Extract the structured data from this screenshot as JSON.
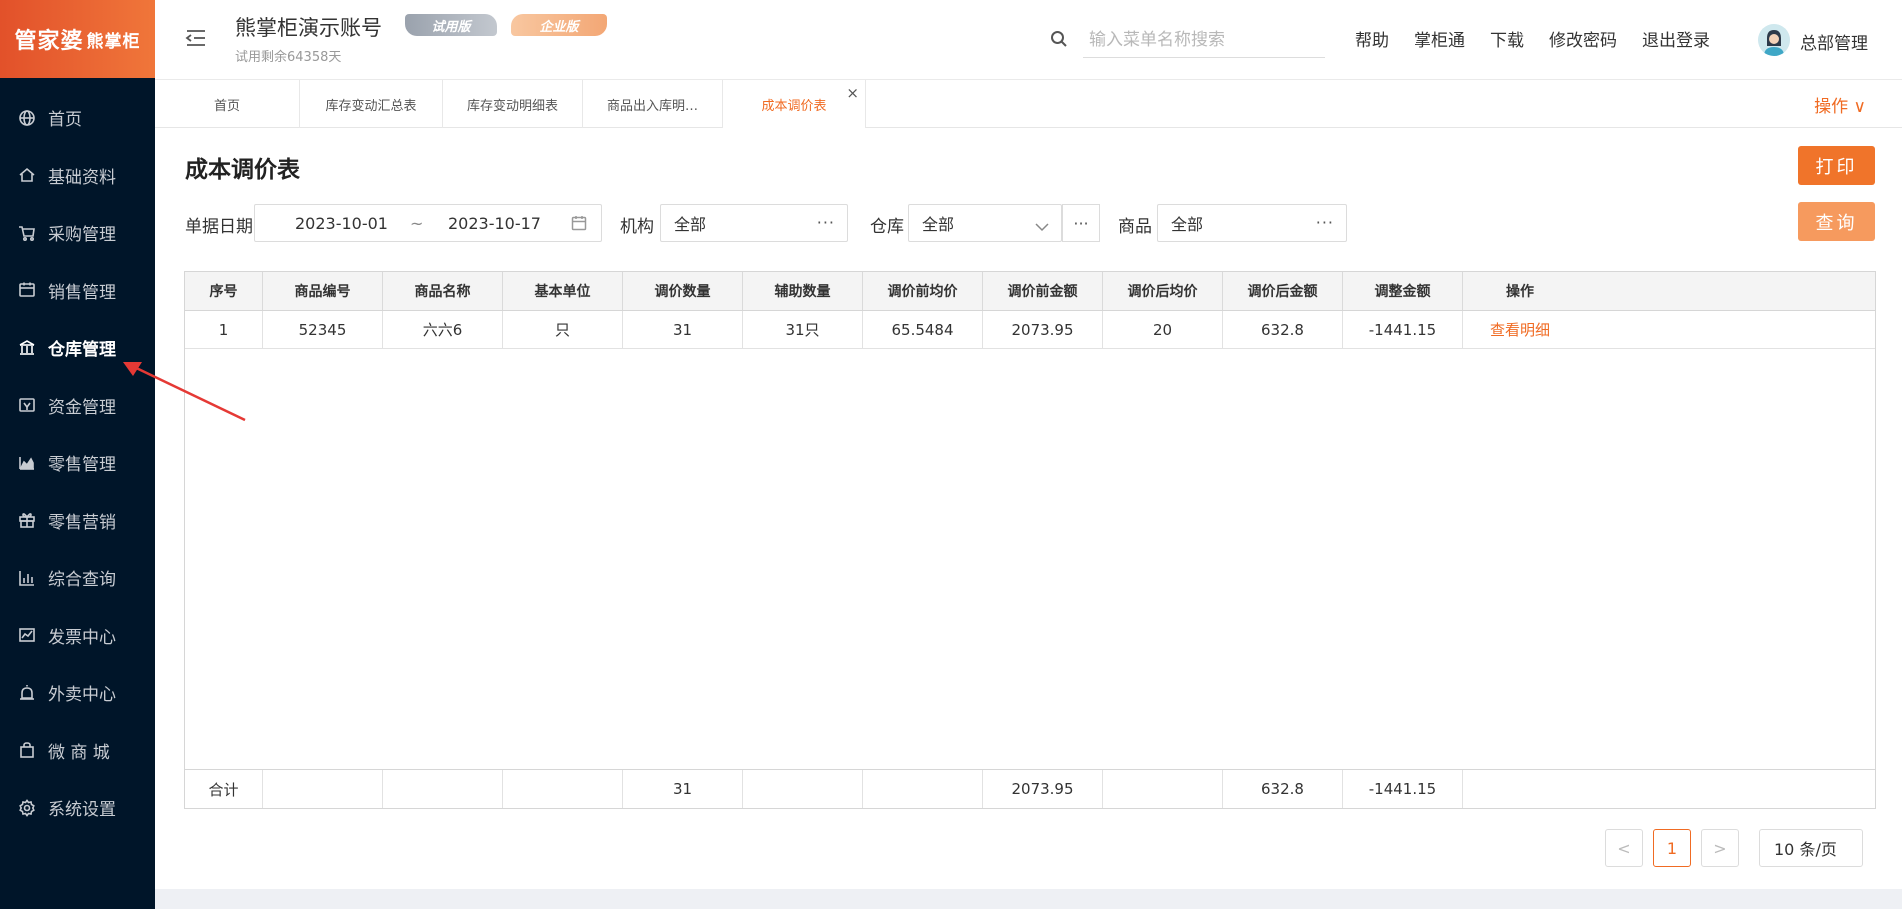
{
  "logo": {
    "text_main": "管家婆",
    "text_small": "熊掌柜"
  },
  "sidebar": {
    "items": [
      {
        "label": "首页",
        "icon": "globe-icon"
      },
      {
        "label": "基础资料",
        "icon": "home-icon"
      },
      {
        "label": "采购管理",
        "icon": "cart-icon"
      },
      {
        "label": "销售管理",
        "icon": "calendar-icon"
      },
      {
        "label": "仓库管理",
        "icon": "bank-icon",
        "active": true
      },
      {
        "label": "资金管理",
        "icon": "wallet-icon"
      },
      {
        "label": "零售管理",
        "icon": "chart-area-icon"
      },
      {
        "label": "零售营销",
        "icon": "gift-icon"
      },
      {
        "label": "综合查询",
        "icon": "bar-chart-icon"
      },
      {
        "label": "发票中心",
        "icon": "line-chart-icon"
      },
      {
        "label": "外卖中心",
        "icon": "alarm-icon"
      },
      {
        "label": "微 商 城",
        "icon": "shopping-bag-icon"
      },
      {
        "label": "系统设置",
        "icon": "gear-icon"
      }
    ]
  },
  "header": {
    "account_title": "熊掌柜演示账号",
    "trial_badge": "试用版",
    "enterprise_badge": "企业版",
    "trial_remaining": "试用剩余64358天",
    "search_placeholder": "输入菜单名称搜索",
    "links": [
      "帮助",
      "掌柜通",
      "下载",
      "修改密码",
      "退出登录"
    ],
    "user_name": "总部管理"
  },
  "tabs": {
    "items": [
      "首页",
      "库存变动汇总表",
      "库存变动明细表",
      "商品出入库明…",
      "成本调价表"
    ],
    "active_index": 4,
    "close_symbol": "×",
    "ops_label": "操作 ∨"
  },
  "page": {
    "title": "成本调价表",
    "print_label": "打印",
    "query_label": "查询"
  },
  "filters": {
    "date_label": "单据日期",
    "date_from": "2023-10-01",
    "date_sep": "~",
    "date_to": "2023-10-17",
    "org_label": "机构",
    "org_value": "全部",
    "warehouse_label": "仓库",
    "warehouse_value": "全部",
    "goods_label": "商品",
    "goods_value": "全部",
    "more": "···"
  },
  "table": {
    "columns": [
      "序号",
      "商品编号",
      "商品名称",
      "基本单位",
      "调价数量",
      "辅助数量",
      "调价前均价",
      "调价前金额",
      "调价后均价",
      "调价后金额",
      "调整金额",
      "操作"
    ],
    "rows": [
      [
        "1",
        "52345",
        "六六6",
        "只",
        "31",
        "31只",
        "65.5484",
        "2073.95",
        "20",
        "632.8",
        "-1441.15",
        "查看明细"
      ]
    ],
    "footer": [
      "合计",
      "",
      "",
      "",
      "31",
      "",
      "",
      "2073.95",
      "",
      "632.8",
      "-1441.15",
      ""
    ]
  },
  "pagination": {
    "prev": "<",
    "current": "1",
    "next": ">",
    "page_size": "10 条/页"
  },
  "colors": {
    "accent": "#f06b23",
    "sidebar_bg": "#001529",
    "annotation_arrow": "#e53935"
  }
}
